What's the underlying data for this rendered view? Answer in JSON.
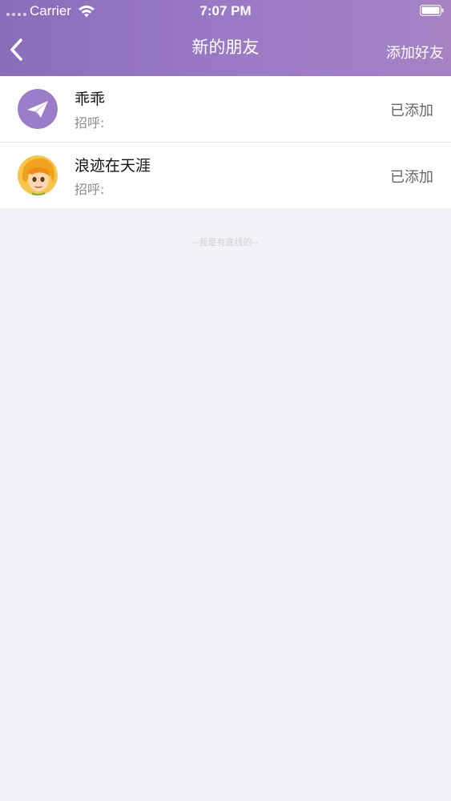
{
  "status_bar": {
    "carrier": "Carrier",
    "time": "7:07 PM"
  },
  "nav": {
    "title": "新的朋友",
    "right_action": "添加好友",
    "back_icon": "chevron-left-icon"
  },
  "friends": [
    {
      "name": "乖乖",
      "greeting": "招呼:",
      "status": "已添加",
      "avatar": "paper-plane-icon"
    },
    {
      "name": "浪迹在天涯",
      "greeting": "招呼:",
      "status": "已添加",
      "avatar": "cartoon-face-avatar"
    }
  ],
  "footer_note": "--我是有底线的--",
  "colors": {
    "header_start": "#8a6cb8",
    "header_end": "#a482c4",
    "background": "#f3f2f6",
    "avatar_purple": "#9a7cc8"
  }
}
